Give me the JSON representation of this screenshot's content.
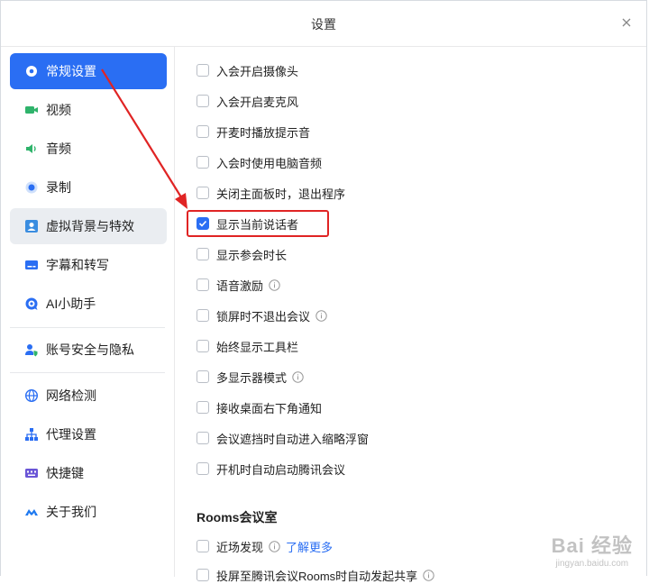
{
  "window": {
    "title": "设置"
  },
  "sidebar": {
    "items": [
      {
        "label": "常规设置",
        "icon": "gear-icon"
      },
      {
        "label": "视频",
        "icon": "video-camera-icon"
      },
      {
        "label": "音频",
        "icon": "speaker-icon"
      },
      {
        "label": "录制",
        "icon": "record-icon"
      },
      {
        "label": "虚拟背景与特效",
        "icon": "portrait-icon"
      },
      {
        "label": "字幕和转写",
        "icon": "caption-icon"
      },
      {
        "label": "AI小助手",
        "icon": "ai-assistant-icon"
      },
      {
        "label": "账号安全与隐私",
        "icon": "user-shield-icon"
      },
      {
        "label": "网络检测",
        "icon": "globe-icon"
      },
      {
        "label": "代理设置",
        "icon": "network-tree-icon"
      },
      {
        "label": "快捷键",
        "icon": "keyboard-icon"
      },
      {
        "label": "关于我们",
        "icon": "tencent-logo-icon"
      }
    ]
  },
  "options": [
    {
      "label": "入会开启摄像头",
      "checked": false
    },
    {
      "label": "入会开启麦克风",
      "checked": false
    },
    {
      "label": "开麦时播放提示音",
      "checked": false
    },
    {
      "label": "入会时使用电脑音频",
      "checked": false
    },
    {
      "label": "关闭主面板时，退出程序",
      "checked": false
    },
    {
      "label": "显示当前说话者",
      "checked": true
    },
    {
      "label": "显示参会时长",
      "checked": false
    },
    {
      "label": "语音激励",
      "checked": false,
      "info": true
    },
    {
      "label": "锁屏时不退出会议",
      "checked": false,
      "info": true
    },
    {
      "label": "始终显示工具栏",
      "checked": false
    },
    {
      "label": "多显示器模式",
      "checked": false,
      "info": true
    },
    {
      "label": "接收桌面右下角通知",
      "checked": false
    },
    {
      "label": "会议遮挡时自动进入缩略浮窗",
      "checked": false
    },
    {
      "label": "开机时自动启动腾讯会议",
      "checked": false
    }
  ],
  "rooms": {
    "title": "Rooms会议室",
    "options": [
      {
        "label": "近场发现",
        "checked": false,
        "info": true,
        "link": "了解更多"
      },
      {
        "label": "投屏至腾讯会议Rooms时自动发起共享",
        "checked": false,
        "info": true
      }
    ]
  },
  "watermark": {
    "main": "Bai 经验",
    "sub": "jingyan.baidu.com"
  },
  "colors": {
    "accent": "#2a6ef3",
    "annotation": "#e02424"
  }
}
